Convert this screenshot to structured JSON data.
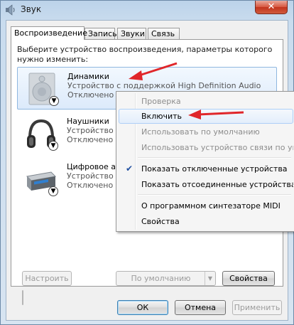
{
  "window": {
    "title": "Звук",
    "close_label": "✕"
  },
  "tabs": [
    {
      "label": "Воспроизведение",
      "active": true
    },
    {
      "label": "Запись",
      "active": false
    },
    {
      "label": "Звуки",
      "active": false
    },
    {
      "label": "Связь",
      "active": false
    }
  ],
  "panel": {
    "prompt": "Выберите устройство воспроизведения, параметры которого нужно изменить:"
  },
  "devices": [
    {
      "name": "Динамики",
      "description": "Устройство с поддержкой High Definition Audio",
      "status": "Отключено",
      "icon": "speaker-icon"
    },
    {
      "name": "Наушники",
      "description": "Устройство с",
      "status": "Отключено",
      "icon": "headphones-icon"
    },
    {
      "name": "Цифровое аудио",
      "description": "Устройство с",
      "status": "Отключено",
      "icon": "digital-audio-icon"
    }
  ],
  "panel_buttons": {
    "configure": "Настроить",
    "default": "По умолчанию",
    "properties": "Свойства"
  },
  "dialog_buttons": {
    "ok": "ОК",
    "cancel": "Отмена",
    "apply": "Применить"
  },
  "context_menu": {
    "items": [
      {
        "label": "Проверка",
        "disabled": true
      },
      {
        "label": "Включить",
        "disabled": false,
        "highlighted": true
      },
      {
        "label": "Использовать по умолчанию",
        "disabled": true
      },
      {
        "label": "Использовать устройство связи по умолчанию",
        "disabled": true
      },
      {
        "label": "Показать отключенные устройства",
        "checked": true
      },
      {
        "label": "Показать отсоединенные устройства",
        "checked": false
      },
      {
        "label": "О программном синтезаторе MIDI"
      },
      {
        "label": "Свойства"
      }
    ]
  },
  "colors": {
    "annotation_arrow": "#e0262a",
    "selection_border": "#8fb7e0"
  }
}
